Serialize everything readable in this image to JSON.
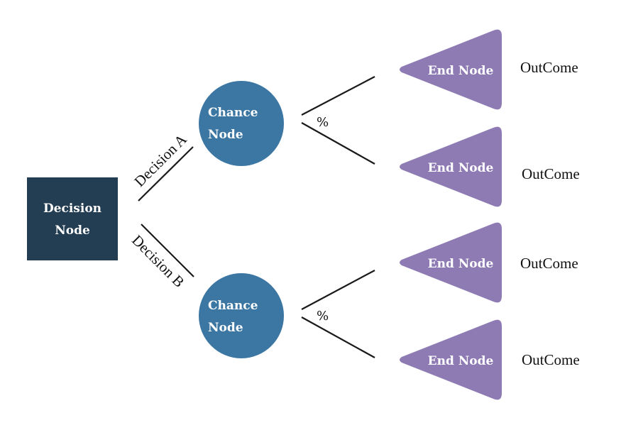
{
  "colors": {
    "decision": "#233d52",
    "chance": "#3c76a3",
    "end": "#8e7bb4",
    "edge": "#1a1a1a"
  },
  "decision_node": {
    "line1": "Decision",
    "line2": "Node"
  },
  "decisions": [
    {
      "label": "Decision A"
    },
    {
      "label": "Decision B"
    }
  ],
  "chance_nodes": [
    {
      "line1": "Chance",
      "line2": "Node",
      "probability": "%"
    },
    {
      "line1": "Chance",
      "line2": "Node",
      "probability": "%"
    }
  ],
  "end_nodes": [
    {
      "label": "End Node",
      "outcome": "OutCome"
    },
    {
      "label": "End Node",
      "outcome": "OutCome"
    },
    {
      "label": "End Node",
      "outcome": "OutCome"
    },
    {
      "label": "End Node",
      "outcome": "OutCome"
    }
  ]
}
